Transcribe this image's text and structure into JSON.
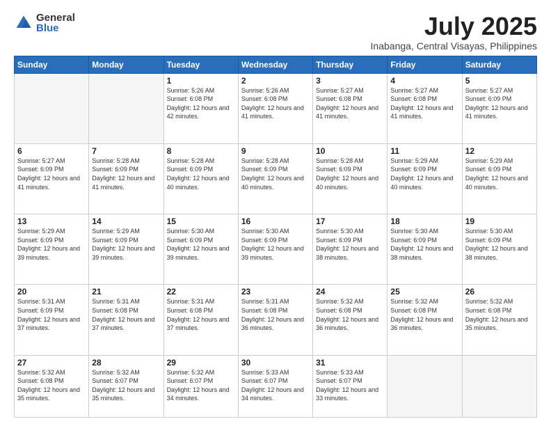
{
  "logo": {
    "general": "General",
    "blue": "Blue"
  },
  "title": {
    "month_year": "July 2025",
    "location": "Inabanga, Central Visayas, Philippines"
  },
  "weekdays": [
    "Sunday",
    "Monday",
    "Tuesday",
    "Wednesday",
    "Thursday",
    "Friday",
    "Saturday"
  ],
  "weeks": [
    [
      {
        "day": "",
        "info": ""
      },
      {
        "day": "",
        "info": ""
      },
      {
        "day": "1",
        "info": "Sunrise: 5:26 AM\nSunset: 6:08 PM\nDaylight: 12 hours and 42 minutes."
      },
      {
        "day": "2",
        "info": "Sunrise: 5:26 AM\nSunset: 6:08 PM\nDaylight: 12 hours and 41 minutes."
      },
      {
        "day": "3",
        "info": "Sunrise: 5:27 AM\nSunset: 6:08 PM\nDaylight: 12 hours and 41 minutes."
      },
      {
        "day": "4",
        "info": "Sunrise: 5:27 AM\nSunset: 6:08 PM\nDaylight: 12 hours and 41 minutes."
      },
      {
        "day": "5",
        "info": "Sunrise: 5:27 AM\nSunset: 6:09 PM\nDaylight: 12 hours and 41 minutes."
      }
    ],
    [
      {
        "day": "6",
        "info": "Sunrise: 5:27 AM\nSunset: 6:09 PM\nDaylight: 12 hours and 41 minutes."
      },
      {
        "day": "7",
        "info": "Sunrise: 5:28 AM\nSunset: 6:09 PM\nDaylight: 12 hours and 41 minutes."
      },
      {
        "day": "8",
        "info": "Sunrise: 5:28 AM\nSunset: 6:09 PM\nDaylight: 12 hours and 40 minutes."
      },
      {
        "day": "9",
        "info": "Sunrise: 5:28 AM\nSunset: 6:09 PM\nDaylight: 12 hours and 40 minutes."
      },
      {
        "day": "10",
        "info": "Sunrise: 5:28 AM\nSunset: 6:09 PM\nDaylight: 12 hours and 40 minutes."
      },
      {
        "day": "11",
        "info": "Sunrise: 5:29 AM\nSunset: 6:09 PM\nDaylight: 12 hours and 40 minutes."
      },
      {
        "day": "12",
        "info": "Sunrise: 5:29 AM\nSunset: 6:09 PM\nDaylight: 12 hours and 40 minutes."
      }
    ],
    [
      {
        "day": "13",
        "info": "Sunrise: 5:29 AM\nSunset: 6:09 PM\nDaylight: 12 hours and 39 minutes."
      },
      {
        "day": "14",
        "info": "Sunrise: 5:29 AM\nSunset: 6:09 PM\nDaylight: 12 hours and 39 minutes."
      },
      {
        "day": "15",
        "info": "Sunrise: 5:30 AM\nSunset: 6:09 PM\nDaylight: 12 hours and 39 minutes."
      },
      {
        "day": "16",
        "info": "Sunrise: 5:30 AM\nSunset: 6:09 PM\nDaylight: 12 hours and 39 minutes."
      },
      {
        "day": "17",
        "info": "Sunrise: 5:30 AM\nSunset: 6:09 PM\nDaylight: 12 hours and 38 minutes."
      },
      {
        "day": "18",
        "info": "Sunrise: 5:30 AM\nSunset: 6:09 PM\nDaylight: 12 hours and 38 minutes."
      },
      {
        "day": "19",
        "info": "Sunrise: 5:30 AM\nSunset: 6:09 PM\nDaylight: 12 hours and 38 minutes."
      }
    ],
    [
      {
        "day": "20",
        "info": "Sunrise: 5:31 AM\nSunset: 6:09 PM\nDaylight: 12 hours and 37 minutes."
      },
      {
        "day": "21",
        "info": "Sunrise: 5:31 AM\nSunset: 6:08 PM\nDaylight: 12 hours and 37 minutes."
      },
      {
        "day": "22",
        "info": "Sunrise: 5:31 AM\nSunset: 6:08 PM\nDaylight: 12 hours and 37 minutes."
      },
      {
        "day": "23",
        "info": "Sunrise: 5:31 AM\nSunset: 6:08 PM\nDaylight: 12 hours and 36 minutes."
      },
      {
        "day": "24",
        "info": "Sunrise: 5:32 AM\nSunset: 6:08 PM\nDaylight: 12 hours and 36 minutes."
      },
      {
        "day": "25",
        "info": "Sunrise: 5:32 AM\nSunset: 6:08 PM\nDaylight: 12 hours and 36 minutes."
      },
      {
        "day": "26",
        "info": "Sunrise: 5:32 AM\nSunset: 6:08 PM\nDaylight: 12 hours and 35 minutes."
      }
    ],
    [
      {
        "day": "27",
        "info": "Sunrise: 5:32 AM\nSunset: 6:08 PM\nDaylight: 12 hours and 35 minutes."
      },
      {
        "day": "28",
        "info": "Sunrise: 5:32 AM\nSunset: 6:07 PM\nDaylight: 12 hours and 35 minutes."
      },
      {
        "day": "29",
        "info": "Sunrise: 5:32 AM\nSunset: 6:07 PM\nDaylight: 12 hours and 34 minutes."
      },
      {
        "day": "30",
        "info": "Sunrise: 5:33 AM\nSunset: 6:07 PM\nDaylight: 12 hours and 34 minutes."
      },
      {
        "day": "31",
        "info": "Sunrise: 5:33 AM\nSunset: 6:07 PM\nDaylight: 12 hours and 33 minutes."
      },
      {
        "day": "",
        "info": ""
      },
      {
        "day": "",
        "info": ""
      }
    ]
  ]
}
